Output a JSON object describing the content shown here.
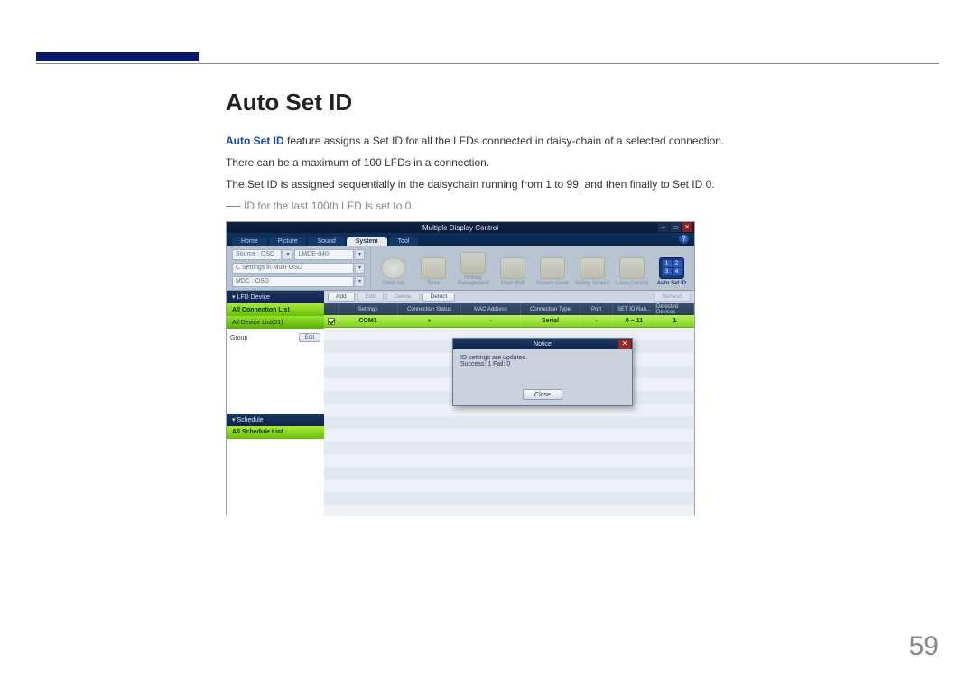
{
  "header": {
    "mark_color": "#0a1a66"
  },
  "doc": {
    "heading": "Auto Set ID",
    "para1_prefix": "Auto Set ID",
    "para1_rest": " feature assigns a Set ID for all the LFDs connected in daisy-chain of a selected connection.",
    "para2": "There can be a maximum of 100 LFDs in a connection.",
    "para3": "The Set ID is assigned sequentially in the daisychain running from 1 to 99, and then finally to Set ID 0.",
    "note": "ID for the last 100th LFD is set to 0.",
    "page_number": "59"
  },
  "app": {
    "title": "Multiple Display Control",
    "win_buttons": {
      "min": "–",
      "max": "▭",
      "close": "✕"
    },
    "tabs": [
      "Home",
      "Picture",
      "Sound",
      "System",
      "Tool"
    ],
    "active_tab": "System",
    "help": "?",
    "ribbon_left": {
      "combo1": "Source : OSD",
      "combo1_arrow": "▾",
      "combo2": "C Settings in Multi-OSD",
      "combo2_arrow": "▾",
      "combo3": "MDC : OSD",
      "combo3_arrow": "▾",
      "combo_right": "LMDE-040",
      "combo_right_arrow": "▾"
    },
    "tools": [
      {
        "label": "Clock Set",
        "kind": "clock"
      },
      {
        "label": "Timer"
      },
      {
        "label": "Holiday\nManagement"
      },
      {
        "label": "Pixel Shift"
      },
      {
        "label": "Screen Saver"
      },
      {
        "label": "Safety\nScreen"
      },
      {
        "label": "Lamp Control"
      },
      {
        "label": "Auto Set ID",
        "kind": "autoset",
        "nums": [
          "1",
          "2",
          "3",
          "4"
        ]
      }
    ],
    "sidebar": {
      "lfd_header": "▾ LFD Device",
      "all_conn": "All Connection List",
      "all_device": "All Device List(01)",
      "group": "Group",
      "edit_btn": "Edit",
      "schedule_header": "▾ Schedule",
      "all_schedule": "All Schedule List"
    },
    "btnrow": {
      "add": "Add",
      "edit": "Edit",
      "delete": "Delete",
      "detect": "Detect",
      "refresh": "Refresh"
    },
    "thead": [
      "",
      "Settings",
      "Connection Status",
      "MAC Address",
      "Connection Type",
      "Port",
      "SET ID Ran...",
      "Detected Devices"
    ],
    "row": {
      "settings": "COM1",
      "conn_status": "●",
      "mac": "-",
      "conn_type": "Serial",
      "port": "-",
      "range": "0 ~ 11",
      "detected": "1"
    },
    "dialog": {
      "title": "Notice",
      "line1": "ID settings are updated.",
      "line2": "Success: 1  Fail: 0",
      "close_label": "Close",
      "x": "✕"
    }
  }
}
